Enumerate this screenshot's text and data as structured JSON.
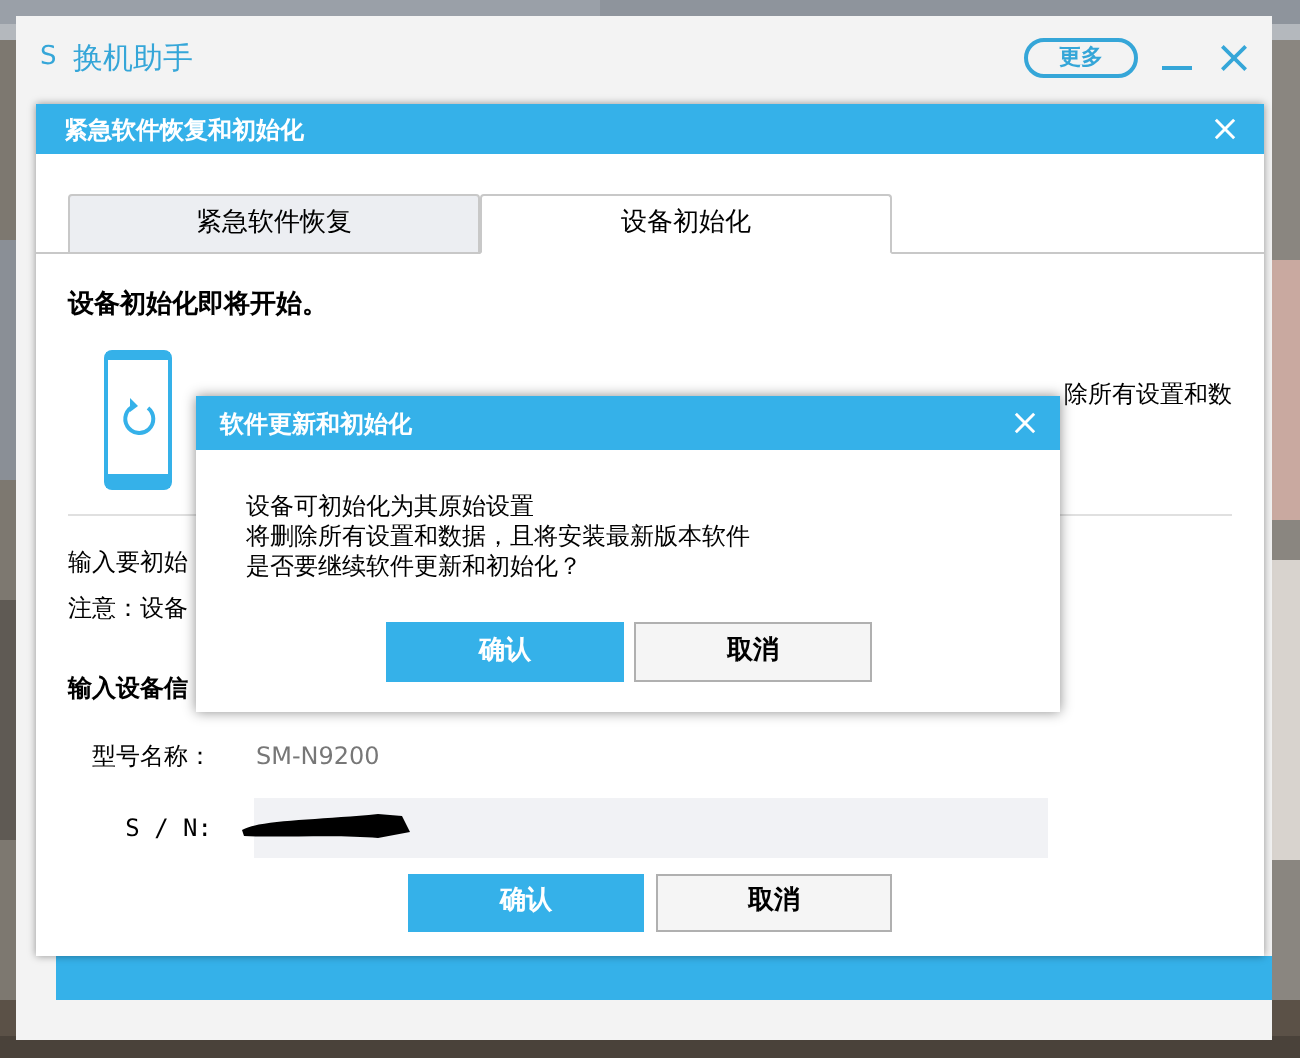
{
  "app_window": {
    "logo": "S",
    "title": "换机助手",
    "more_button": "更多"
  },
  "dialog": {
    "title": "紧急软件恢复和初始化",
    "tabs": [
      {
        "label": "紧急软件恢复",
        "selected": false
      },
      {
        "label": "设备初始化",
        "selected": true
      }
    ],
    "heading": "设备初始化即将开始。",
    "description_visible": "除所有设置和数",
    "instruction_visible": "输入要初始",
    "note_visible": "注意：设备",
    "section_title_visible": "输入设备信",
    "fields": [
      {
        "label": "型号名称：",
        "value": "SM-N9200",
        "kind": "text"
      },
      {
        "label": "S / N:",
        "kind": "redacted"
      }
    ],
    "buttons": [
      {
        "label": "确认",
        "kind": "primary"
      },
      {
        "label": "取消",
        "kind": "secondary"
      }
    ]
  },
  "confirm_dialog": {
    "title": "软件更新和初始化",
    "lines": [
      "设备可初始化为其原始设置",
      "将删除所有设置和数据，且将安装最新版本软件",
      "是否要继续软件更新和初始化？"
    ],
    "buttons": [
      {
        "label": "确认",
        "kind": "primary"
      },
      {
        "label": "取消",
        "kind": "secondary"
      }
    ]
  }
}
